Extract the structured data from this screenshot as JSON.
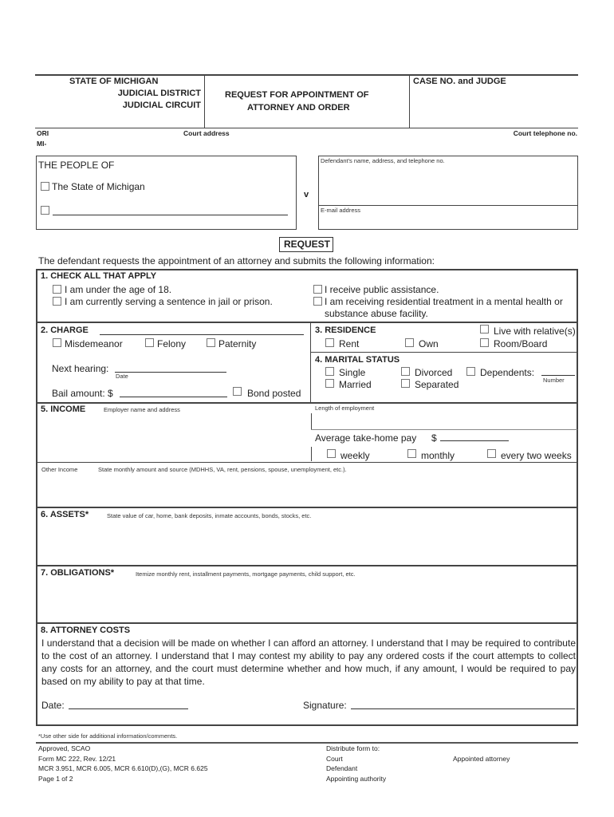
{
  "header": {
    "state": "STATE OF MICHIGAN",
    "district": "JUDICIAL DISTRICT",
    "circuit": "JUDICIAL CIRCUIT",
    "title_line1": "REQUEST FOR APPOINTMENT OF",
    "title_line2": "ATTORNEY AND ORDER",
    "case_no_label": "CASE NO. and JUDGE",
    "ori_label": "ORI",
    "ori_value": "MI-",
    "court_address_label": "Court address",
    "court_phone_label": "Court telephone no."
  },
  "parties": {
    "people_of": "THE PEOPLE OF",
    "state_option": "The State of Michigan",
    "versus": "v",
    "defendant_label": "Defendant's name, address, and telephone no.",
    "email_label": "E-mail address"
  },
  "request": {
    "heading": "REQUEST",
    "intro": "The defendant requests the appointment of an attorney and submits the following information:"
  },
  "section1": {
    "title": "1. CHECK ALL THAT APPLY",
    "options": [
      "I am under the age of 18.",
      "I am currently serving a sentence in jail or prison.",
      "I receive public assistance.",
      "I am receiving residential treatment in a mental health or",
      "substance abuse facility."
    ]
  },
  "section2": {
    "title": "2. CHARGE",
    "options": [
      "Misdemeanor",
      "Felony",
      "Paternity"
    ],
    "next_hearing_label": "Next hearing:",
    "date_label": "Date",
    "bail_label": "Bail amount: $",
    "bond_posted": "Bond posted"
  },
  "section3": {
    "title": "3. RESIDENCE",
    "options": [
      "Rent",
      "Own",
      "Live with relative(s)",
      "Room/Board"
    ]
  },
  "section4": {
    "title": "4. MARITAL STATUS",
    "options": [
      "Single",
      "Married",
      "Divorced",
      "Separated",
      "Dependents:"
    ],
    "number_label": "Number"
  },
  "section5": {
    "title": "5. INCOME",
    "employer_label": "Employer name and address",
    "length_label": "Length of employment",
    "pay_label": "Average take-home pay",
    "dollar": "$",
    "frequency": [
      "weekly",
      "monthly",
      "every two weeks"
    ],
    "other_income_label": "Other Income",
    "other_income_hint": "State monthly amount and source (MDHHS, VA, rent, pensions, spouse, unemployment, etc.)."
  },
  "section6": {
    "title": "6. ASSETS*",
    "hint": "State value of car, home, bank deposits, inmate accounts, bonds, stocks, etc."
  },
  "section7": {
    "title": "7. OBLIGATIONS*",
    "hint": "Itemize monthly rent, installment payments, mortgage payments, child support, etc."
  },
  "section8": {
    "title": "8. ATTORNEY COSTS",
    "text": "I understand that a decision will be made on whether I can afford an attorney. I understand that I may be required to contribute to the cost of an attorney. I understand that I may contest my ability to pay any ordered costs if the court attempts to collect any costs for an attorney, and the court must determine whether and how much, if any amount, I would be required to pay based on my ability to pay at that time.",
    "date_label": "Date:",
    "signature_label": "Signature:"
  },
  "footer": {
    "note": "*Use other side for additional information/comments.",
    "approved": "Approved, SCAO",
    "form": "Form MC 222, Rev. 12/21",
    "rules": "MCR 3.951, MCR 6.005, MCR 6.610(D),(G), MCR 6.625",
    "page": "Page 1 of 2",
    "distribute_label": "Distribute form to:",
    "distribute_list": [
      "Court",
      "Defendant",
      "Appointing authority",
      "Appointed attorney"
    ]
  }
}
